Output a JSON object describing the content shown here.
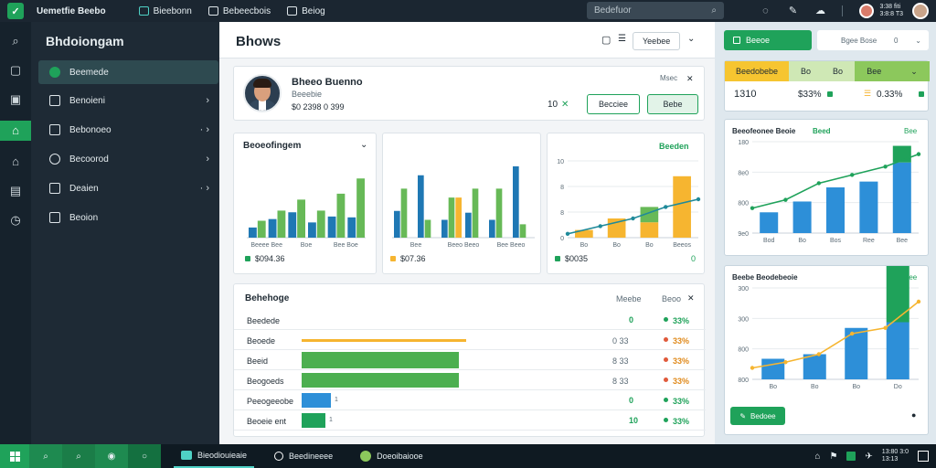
{
  "topbar": {
    "app_title": "Uemetfie Beebo",
    "items": [
      {
        "label": "Bieebonn",
        "icon": "monitor-icon"
      },
      {
        "label": "Bebeecbois",
        "icon": "folder-icon"
      },
      {
        "label": "Beiog",
        "icon": "window-icon"
      }
    ],
    "search_placeholder": "Bedefuor",
    "clock": "3:38 fiti",
    "date": "3:8:8 T3"
  },
  "sidebar": {
    "title": "Bhdoiongam",
    "items": [
      {
        "label": "Beemede",
        "icon": "circle-icon",
        "active": true,
        "has_chevron": false
      },
      {
        "label": "Benoieni",
        "icon": "pen-icon",
        "active": false,
        "has_chevron": true
      },
      {
        "label": "Bebonoeo",
        "icon": "calendar-icon",
        "active": false,
        "has_chevron": true
      },
      {
        "label": "Becoorod",
        "icon": "chat-icon",
        "active": false,
        "has_chevron": true
      },
      {
        "label": "Deaien",
        "icon": "message-icon",
        "active": false,
        "has_chevron": true
      },
      {
        "label": "Beoion",
        "icon": "grid-icon",
        "active": false,
        "has_chevron": false
      }
    ]
  },
  "header": {
    "title": "Bhows",
    "filter_label": "Yeebee"
  },
  "profile": {
    "name": "Bheeo Buenno",
    "role": "Beeebie",
    "stats": "$0 2398 0 399",
    "count": "10",
    "tag": "Msec",
    "button_primary": "Becciee",
    "button_secondary": "Bebe"
  },
  "charts": {
    "chart1_title": "Beoeofingem",
    "chart1_axis": [
      "Beeee Bee",
      "Boe",
      "Bee Boe"
    ],
    "chart1_total": "$094.36",
    "chart2_axis": [
      "Bee",
      "Beeo Beeo",
      "Bee Beeo"
    ],
    "chart2_total": "$07.36",
    "chart3_badge": "Beeden",
    "chart3_y": [
      "10",
      "8",
      "8",
      "0"
    ],
    "chart3_x": [
      "Bo",
      "Bo",
      "Bo",
      "Beeos"
    ],
    "chart3_total": "$0035",
    "chart3_value": "0"
  },
  "table": {
    "title": "Behehoge",
    "filter_a": "Meebe",
    "filter_b": "Beoo",
    "rows": [
      {
        "label": "Beedede",
        "mid": "",
        "num": "0",
        "pct": "33%"
      },
      {
        "label": "Beoede",
        "mid": "0 33",
        "num": "0",
        "pct": "33%"
      },
      {
        "label": "Beeid",
        "mid": "8 33",
        "num": "8",
        "pct": "33%"
      },
      {
        "label": "Beogoeds",
        "mid": "8 33",
        "num": "8",
        "pct": "33%"
      },
      {
        "label": "Peeogeeobe",
        "mid": "",
        "num": "0",
        "pct": "33%"
      },
      {
        "label": "Beoeie ent",
        "mid": "",
        "num": "10",
        "pct": "33%"
      }
    ]
  },
  "right_panel": {
    "primary_button": "Beeoe",
    "select_value": "Bgee Bose",
    "select_num": "0",
    "kpis": [
      "Beedobebe",
      "Bo",
      "Bo",
      "Bee"
    ],
    "kpi_values": [
      "1310",
      "$33%",
      "0.33%"
    ],
    "chart1_title": "Beeofeonee Beoie",
    "chart1_badge": "Beed",
    "chart1_legend": "Bee",
    "chart1_y": [
      "180",
      "8e0",
      "800",
      "9e0"
    ],
    "chart1_x": [
      "Bod",
      "Bo",
      "Bos",
      "Ree",
      "Bee"
    ],
    "chart2_title": "Beebe Beodebeoie",
    "chart2_legend": "Bee",
    "chart2_y": [
      "300",
      "300",
      "800",
      "800"
    ],
    "chart2_x": [
      "Bo",
      "Bo",
      "Bo",
      "Do"
    ],
    "bottom_button": "Bedoee"
  },
  "taskbar": {
    "apps": [
      {
        "label": "Bieodiouieaie",
        "icon": "picture-icon"
      },
      {
        "label": "Beedineeee",
        "icon": "camera-icon"
      },
      {
        "label": "Doeoibaiooe",
        "icon": "browser-icon"
      }
    ],
    "clock": "13:80 3:0",
    "date": "13:13"
  },
  "chart_data": [
    {
      "type": "bar",
      "series": [
        {
          "color": "#1f78b4",
          "values": [
            12,
            22,
            30,
            18,
            25,
            24
          ]
        },
        {
          "color": "#67b957",
          "values": [
            20,
            32,
            45,
            32,
            52,
            70
          ]
        }
      ],
      "ylim": [
        0,
        80
      ]
    },
    {
      "type": "bar",
      "series": [
        {
          "color": "#1f78b4",
          "values": [
            30,
            70,
            20,
            28,
            20,
            80
          ]
        },
        {
          "color": "#67b957",
          "values": [
            55,
            20,
            45,
            55,
            55,
            15
          ]
        },
        {
          "color": "#f6b530",
          "values": [
            0,
            0,
            45,
            0,
            0,
            0
          ]
        }
      ],
      "ylim": [
        0,
        80
      ]
    },
    {
      "type": "bar",
      "categories": [
        "Bo",
        "Bo",
        "Bo",
        "Beeos"
      ],
      "series": [
        {
          "color": "#f6b530",
          "values": [
            2,
            5,
            4,
            16
          ]
        },
        {
          "color": "#67b957",
          "values": [
            0,
            0,
            4,
            0
          ]
        }
      ],
      "line": [
        1,
        3,
        5,
        8,
        10
      ],
      "ylim": [
        0,
        20
      ]
    },
    {
      "type": "bar",
      "categories": [
        "Bod",
        "Bo",
        "Bos",
        "Ree",
        "Bee"
      ],
      "series": [
        {
          "color": "#2d8fd8",
          "values": [
            25,
            38,
            55,
            62,
            85
          ]
        },
        {
          "color": "#1fa25a",
          "values": [
            0,
            0,
            0,
            0,
            20
          ]
        }
      ],
      "line": [
        30,
        40,
        60,
        70,
        80,
        95
      ],
      "ylim": [
        0,
        110
      ]
    },
    {
      "type": "bar",
      "categories": [
        "Bo",
        "Bo",
        "Bo",
        "Do"
      ],
      "series": [
        {
          "color": "#2d8fd8",
          "values": [
            18,
            22,
            45,
            50
          ]
        },
        {
          "color": "#1fa25a",
          "values": [
            0,
            0,
            0,
            75
          ]
        }
      ],
      "line": [
        10,
        15,
        22,
        40,
        45,
        68
      ],
      "ylim": [
        0,
        80
      ]
    }
  ]
}
